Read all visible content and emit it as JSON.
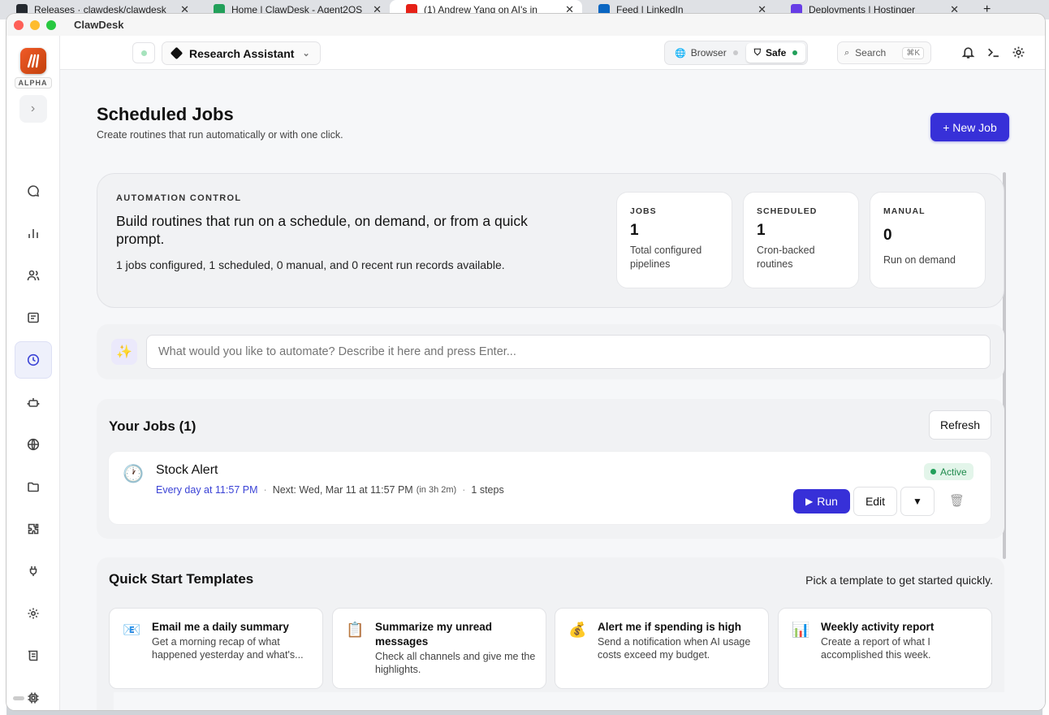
{
  "browser_tabs": [
    {
      "title": "Releases · clawdesk/clawdesk",
      "color": "#24292f"
    },
    {
      "title": "Home | ClawDesk - Agent2OS",
      "color": "#22a05a"
    },
    {
      "title": "(1) Andrew Yang on AI's in",
      "color": "#e62117"
    },
    {
      "title": "Feed | LinkedIn",
      "color": "#0a66c2"
    },
    {
      "title": "Deployments | Hostinger",
      "color": "#673de6"
    }
  ],
  "new_tab": "+",
  "app": {
    "title": "ClawDesk",
    "badge": "ALPHA"
  },
  "topbar": {
    "agent_name": "Research Assistant",
    "modes": [
      {
        "label": "Browser",
        "dot": "#c9c9cc"
      },
      {
        "label": "Safe",
        "dot": "#22a05a"
      }
    ],
    "search_label": "Search",
    "search_shortcut": "⌘K"
  },
  "page": {
    "title": "Scheduled Jobs",
    "subtitle": "Create routines that run automatically or with one click.",
    "new_job_label": "+ New Job"
  },
  "automation": {
    "label": "AUTOMATION CONTROL",
    "headline": "Build routines that run on a schedule, on demand, or from a quick prompt.",
    "summary": "1 jobs configured, 1 scheduled, 0 manual, and 0 recent run records available.",
    "stats": [
      {
        "label": "JOBS",
        "value": "1",
        "desc": "Total configured pipelines"
      },
      {
        "label": "SCHEDULED",
        "value": "1",
        "desc": "Cron-backed routines"
      },
      {
        "label": "MANUAL",
        "value": "0",
        "desc": "Run on demand"
      }
    ]
  },
  "prompt": {
    "placeholder": "What would you like to automate? Describe it here and press Enter...",
    "icon": "✨"
  },
  "jobs": {
    "title": "Your Jobs (1)",
    "refresh_label": "Refresh",
    "items": [
      {
        "name": "Stock Alert",
        "schedule": "Every day at 11:57 PM",
        "next": "Next: Wed, Mar 11 at 11:57 PM",
        "next_relative": "(in 3h 2m)",
        "steps": "1 steps",
        "status": "Active",
        "run_label": "Run",
        "edit_label": "Edit"
      }
    ]
  },
  "templates": {
    "title": "Quick Start Templates",
    "hint": "Pick a template to get started quickly.",
    "items": [
      {
        "icon": "📧",
        "name": "Email me a daily summary",
        "desc": "Get a morning recap of what happened yesterday and what's..."
      },
      {
        "icon": "📋",
        "name": "Summarize my unread messages",
        "desc": "Check all channels and give me the highlights."
      },
      {
        "icon": "💰",
        "name": "Alert me if spending is high",
        "desc": "Send a notification when AI usage costs exceed my budget."
      },
      {
        "icon": "📊",
        "name": "Weekly activity report",
        "desc": "Create a report of what I accomplished this week."
      }
    ]
  },
  "colors": {
    "accent": "#3730d8",
    "active_green": "#22a05a",
    "logo": "#f05a28"
  }
}
